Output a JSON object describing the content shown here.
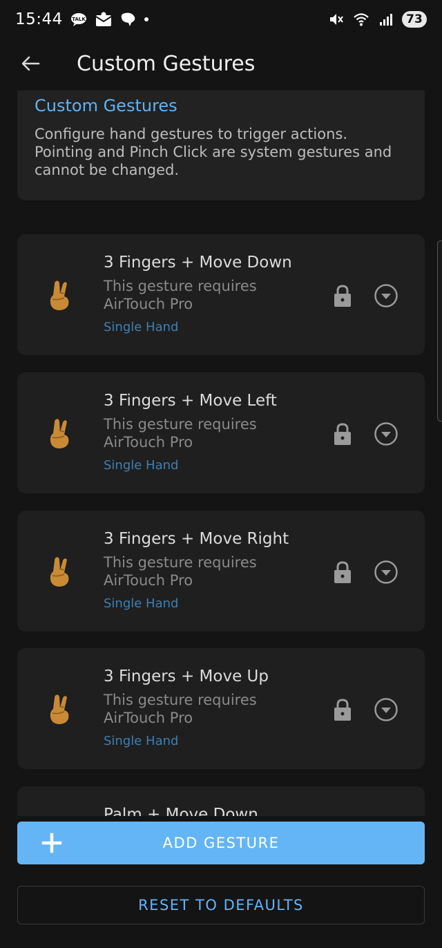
{
  "status_bar": {
    "time": "15:44",
    "battery": "73",
    "left_icons": [
      "talk-icon",
      "mail-icon",
      "chat-bubble-icon",
      "notification-dot-icon"
    ],
    "right_icons": [
      "mute-icon",
      "wifi-icon",
      "signal-icon",
      "battery-icon"
    ]
  },
  "app_bar": {
    "title": "Custom Gestures",
    "back_icon": "arrow-left-icon"
  },
  "info_card": {
    "title": "Custom Gestures",
    "description": "Configure hand gestures to trigger actions. Pointing and Pinch Click are system gestures and cannot be changed."
  },
  "gestures": [
    {
      "name": "3 Fingers + Move Down",
      "requirement": "This gesture requires AirTouch Pro",
      "mode": "Single Hand",
      "icon": "crossed-fingers-icon"
    },
    {
      "name": "3 Fingers + Move Left",
      "requirement": "This gesture requires AirTouch Pro",
      "mode": "Single Hand",
      "icon": "crossed-fingers-icon"
    },
    {
      "name": "3 Fingers + Move Right",
      "requirement": "This gesture requires AirTouch Pro",
      "mode": "Single Hand",
      "icon": "crossed-fingers-icon"
    },
    {
      "name": "3 Fingers + Move Up",
      "requirement": "This gesture requires AirTouch Pro",
      "mode": "Single Hand",
      "icon": "crossed-fingers-icon"
    },
    {
      "name": "Palm + Move Down",
      "requirement": "",
      "mode": "",
      "icon": "palm-icon"
    }
  ],
  "actions": {
    "add_label": "ADD GESTURE",
    "reset_label": "RESET TO DEFAULTS"
  },
  "colors": {
    "background": "#141414",
    "card": "#1f1f1f",
    "accent": "#64b5f6",
    "mode_text": "#3f7fb3"
  }
}
